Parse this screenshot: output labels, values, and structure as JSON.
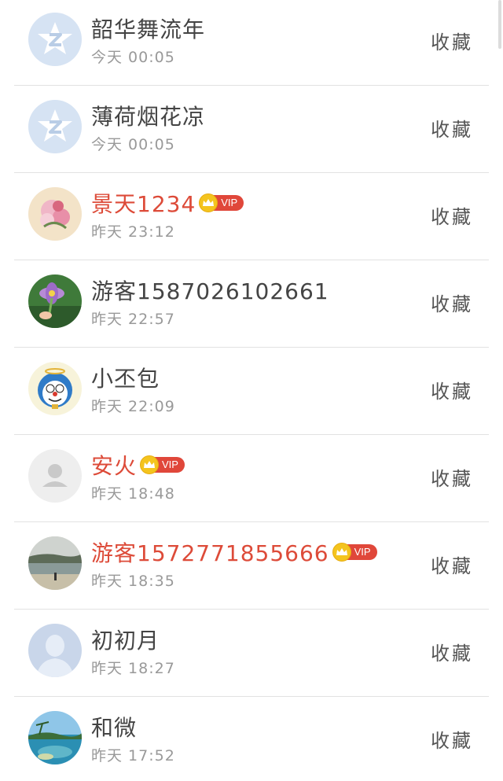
{
  "favorite_label": "收藏",
  "vip_label": "VIP",
  "colors": {
    "vip_name": "#dd4b39",
    "vip_badge": "#e0473a",
    "crown": "#f4c41e",
    "name": "#444444",
    "time": "#999999"
  },
  "items": [
    {
      "name": "韶华舞流年",
      "time": "今天 00:05",
      "vip": false,
      "avatar": "qzone-star-avatar"
    },
    {
      "name": "薄荷烟花凉",
      "time": "今天 00:05",
      "vip": false,
      "avatar": "qzone-star-avatar"
    },
    {
      "name": "景天1234",
      "time": "昨天 23:12",
      "vip": true,
      "avatar": "flower-avatar"
    },
    {
      "name": "游客1587026102661",
      "time": "昨天 22:57",
      "vip": false,
      "avatar": "purple-flower-avatar"
    },
    {
      "name": "小丕包",
      "time": "昨天 22:09",
      "vip": false,
      "avatar": "cartoon-avatar"
    },
    {
      "name": "安火",
      "time": "昨天 18:48",
      "vip": true,
      "avatar": "default-avatar"
    },
    {
      "name": "游客1572771855666",
      "time": "昨天 18:35",
      "vip": true,
      "avatar": "beach-avatar"
    },
    {
      "name": "初初月",
      "time": "昨天 18:27",
      "vip": false,
      "avatar": "default-person-avatar"
    },
    {
      "name": "和微",
      "time": "昨天 17:52",
      "vip": false,
      "avatar": "island-avatar"
    }
  ]
}
